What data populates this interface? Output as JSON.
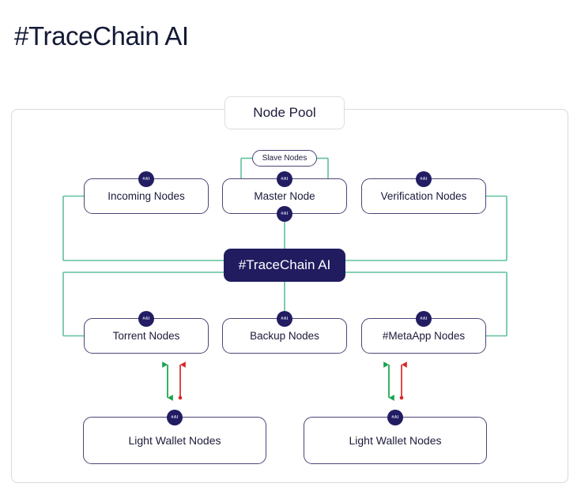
{
  "page": {
    "title": "#TraceChain AI",
    "background": "#ffffff"
  },
  "colors": {
    "text_dark": "#141a35",
    "node_border": "#4b4577",
    "badge_fill": "#221d62",
    "hub_fill": "#211c60",
    "hub_text": "#ffffff",
    "connector_green": "#5fbf9b",
    "arrow_green": "#16a34a",
    "arrow_red": "#dc2626",
    "container_border": "#d9d9e0"
  },
  "container": {
    "section_label": "Node Pool"
  },
  "labels": {
    "slave_nodes": "Slave Nodes"
  },
  "badge": {
    "text": "#AI",
    "icon": "ai-badge-icon"
  },
  "hub": {
    "label": "#TraceChain AI"
  },
  "rows": {
    "row1": [
      {
        "id": "incoming",
        "label": "Incoming Nodes",
        "badge": "#AI"
      },
      {
        "id": "master",
        "label": "Master Node",
        "badge": "#AI"
      },
      {
        "id": "verification",
        "label": "Verification Nodes",
        "badge": "#AI"
      }
    ],
    "row2": [
      {
        "id": "torrent",
        "label": "Torrent Nodes",
        "badge": "#AI"
      },
      {
        "id": "backup",
        "label": "Backup Nodes",
        "badge": "#AI"
      },
      {
        "id": "metaapp",
        "label": "#MetaApp Nodes",
        "badge": "#AI"
      }
    ],
    "row3": [
      {
        "id": "wallet-left",
        "label": "Light Wallet Nodes",
        "badge": "#AI"
      },
      {
        "id": "wallet-right",
        "label": "Light Wallet Nodes",
        "badge": "#AI"
      }
    ]
  },
  "arrows": {
    "pairs": [
      {
        "name": "torrent-to-wallet-left",
        "down_color": "#16a34a",
        "up_color": "#dc2626"
      },
      {
        "name": "metaapp-to-wallet-right",
        "down_color": "#16a34a",
        "up_color": "#dc2626"
      }
    ]
  }
}
